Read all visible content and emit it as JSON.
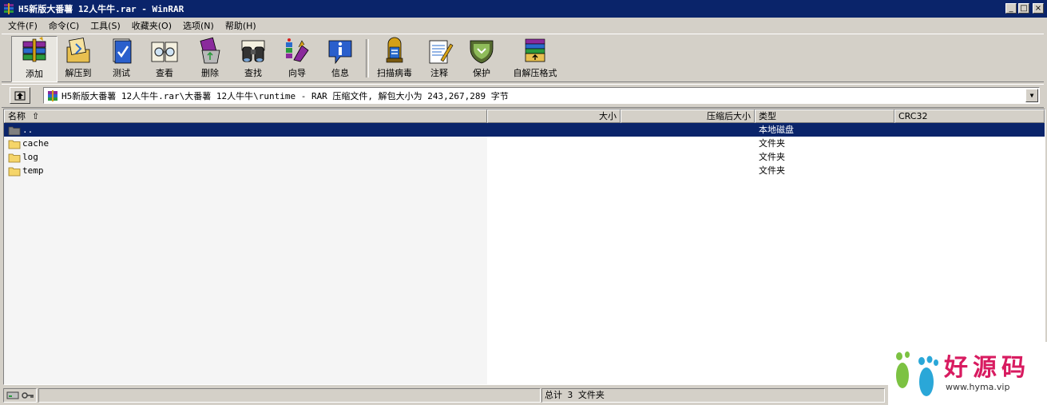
{
  "window": {
    "title": "H5新版大番薯 12人牛牛.rar - WinRAR",
    "controls": [
      "_",
      "□",
      "×"
    ]
  },
  "menu": [
    {
      "label": "文件(F)"
    },
    {
      "label": "命令(C)"
    },
    {
      "label": "工具(S)"
    },
    {
      "label": "收藏夹(O)"
    },
    {
      "label": "选项(N)"
    },
    {
      "label": "帮助(H)"
    }
  ],
  "toolbar": [
    {
      "label": "添加",
      "icon": "books-add-icon"
    },
    {
      "label": "解压到",
      "icon": "extract-folder-icon"
    },
    {
      "label": "测试",
      "icon": "test-book-icon"
    },
    {
      "label": "查看",
      "icon": "view-glasses-icon"
    },
    {
      "label": "删除",
      "icon": "delete-recycle-icon"
    },
    {
      "label": "查找",
      "icon": "find-binoculars-icon"
    },
    {
      "label": "向导",
      "icon": "wizard-icon"
    },
    {
      "label": "信息",
      "icon": "info-icon"
    },
    {
      "label": "扫描病毒",
      "icon": "virus-scan-icon"
    },
    {
      "label": "注释",
      "icon": "comment-icon"
    },
    {
      "label": "保护",
      "icon": "protect-shield-icon"
    },
    {
      "label": "自解压格式",
      "icon": "sfx-icon"
    }
  ],
  "address": {
    "path": "H5新版大番薯 12人牛牛.rar\\大番薯 12人牛牛\\runtime - RAR 压缩文件, 解包大小为 243,267,289 字节"
  },
  "columns": {
    "name": "名称",
    "size": "大小",
    "packed": "压缩后大小",
    "type": "类型",
    "crc": "CRC32"
  },
  "files": [
    {
      "name": "..",
      "type": "本地磁盘",
      "selected": true
    },
    {
      "name": "cache",
      "type": "文件夹",
      "selected": false
    },
    {
      "name": "log",
      "type": "文件夹",
      "selected": false
    },
    {
      "name": "temp",
      "type": "文件夹",
      "selected": false
    }
  ],
  "status": {
    "summary": "总计 3 文件夹"
  },
  "watermark": {
    "brand": "好源码",
    "url": "www.hyma.vip"
  },
  "colors": {
    "titlebar": "#0a246a",
    "selection": "#0a246a",
    "chrome": "#d4d0c8",
    "folder": "#f5d56a",
    "watermark": "#d81b60"
  }
}
